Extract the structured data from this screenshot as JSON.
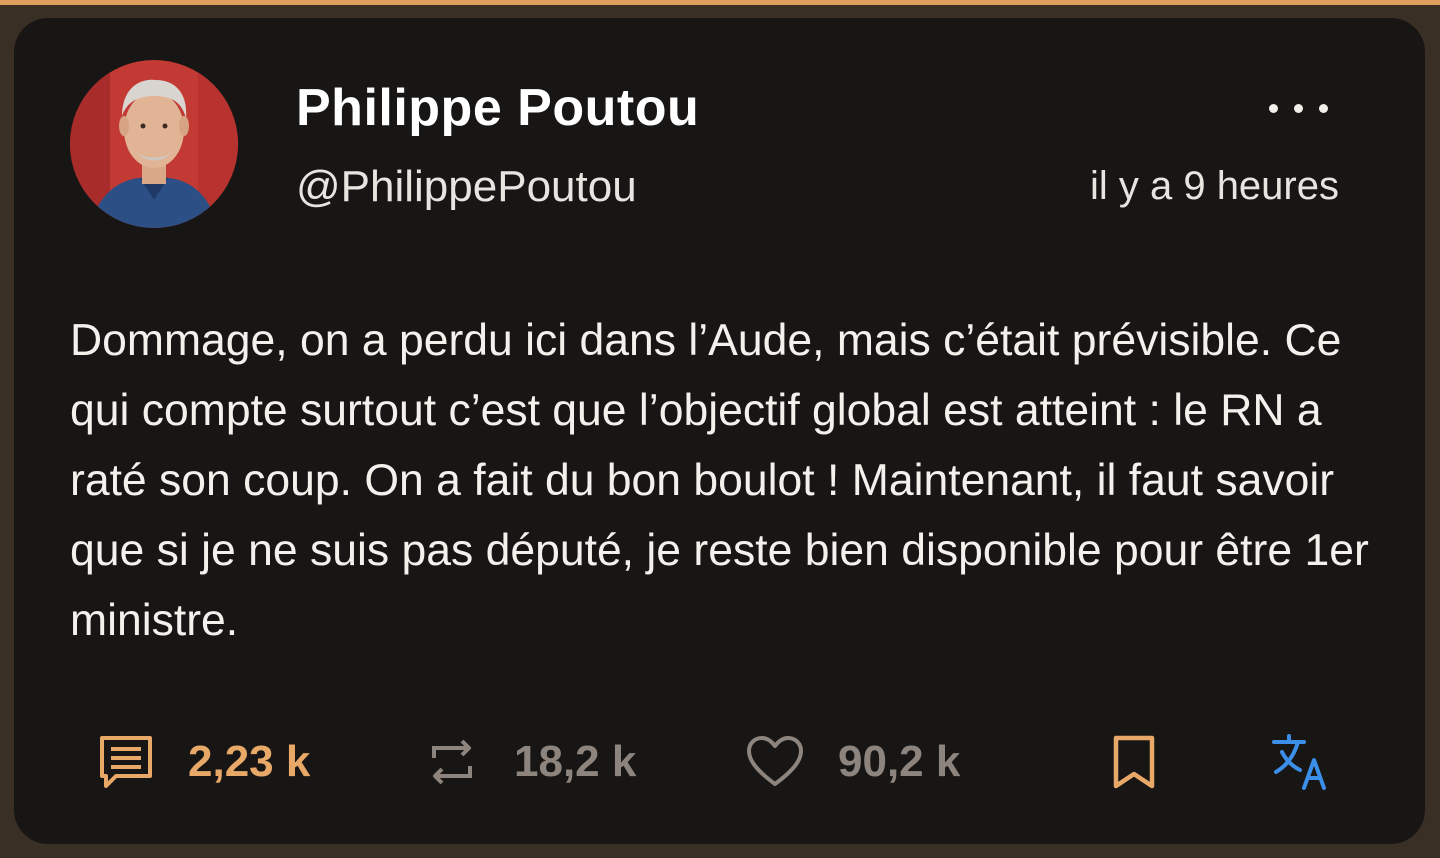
{
  "colors": {
    "accent": "#e8a868",
    "muted": "#8d857d",
    "translate_blue": "#3b8fe8",
    "card_bg": "#181615",
    "frame_bg": "#3a2f25"
  },
  "tweet": {
    "author": {
      "display_name": "Philippe Poutou",
      "handle": "@PhilippePoutou",
      "avatar_icon": "profile-photo"
    },
    "timestamp": "il y a 9 heures",
    "text": "Dommage, on a perdu ici dans l’Aude, mais c’était prévisible. Ce qui compte surtout c’est que l’objectif global est atteint : le RN a raté son coup. On a fait du bon boulot ! Maintenant, il faut savoir que si je ne suis pas député, je reste bien disponible pour être 1er ministre.",
    "actions": {
      "replies": "2,23 k",
      "retweets": "18,2 k",
      "likes": "90,2 k"
    },
    "icons": {
      "reply": "comment-icon",
      "retweet": "retweet-icon",
      "like": "heart-icon",
      "bookmark": "bookmark-icon",
      "translate": "translate-icon",
      "more": "more-options-icon"
    }
  }
}
